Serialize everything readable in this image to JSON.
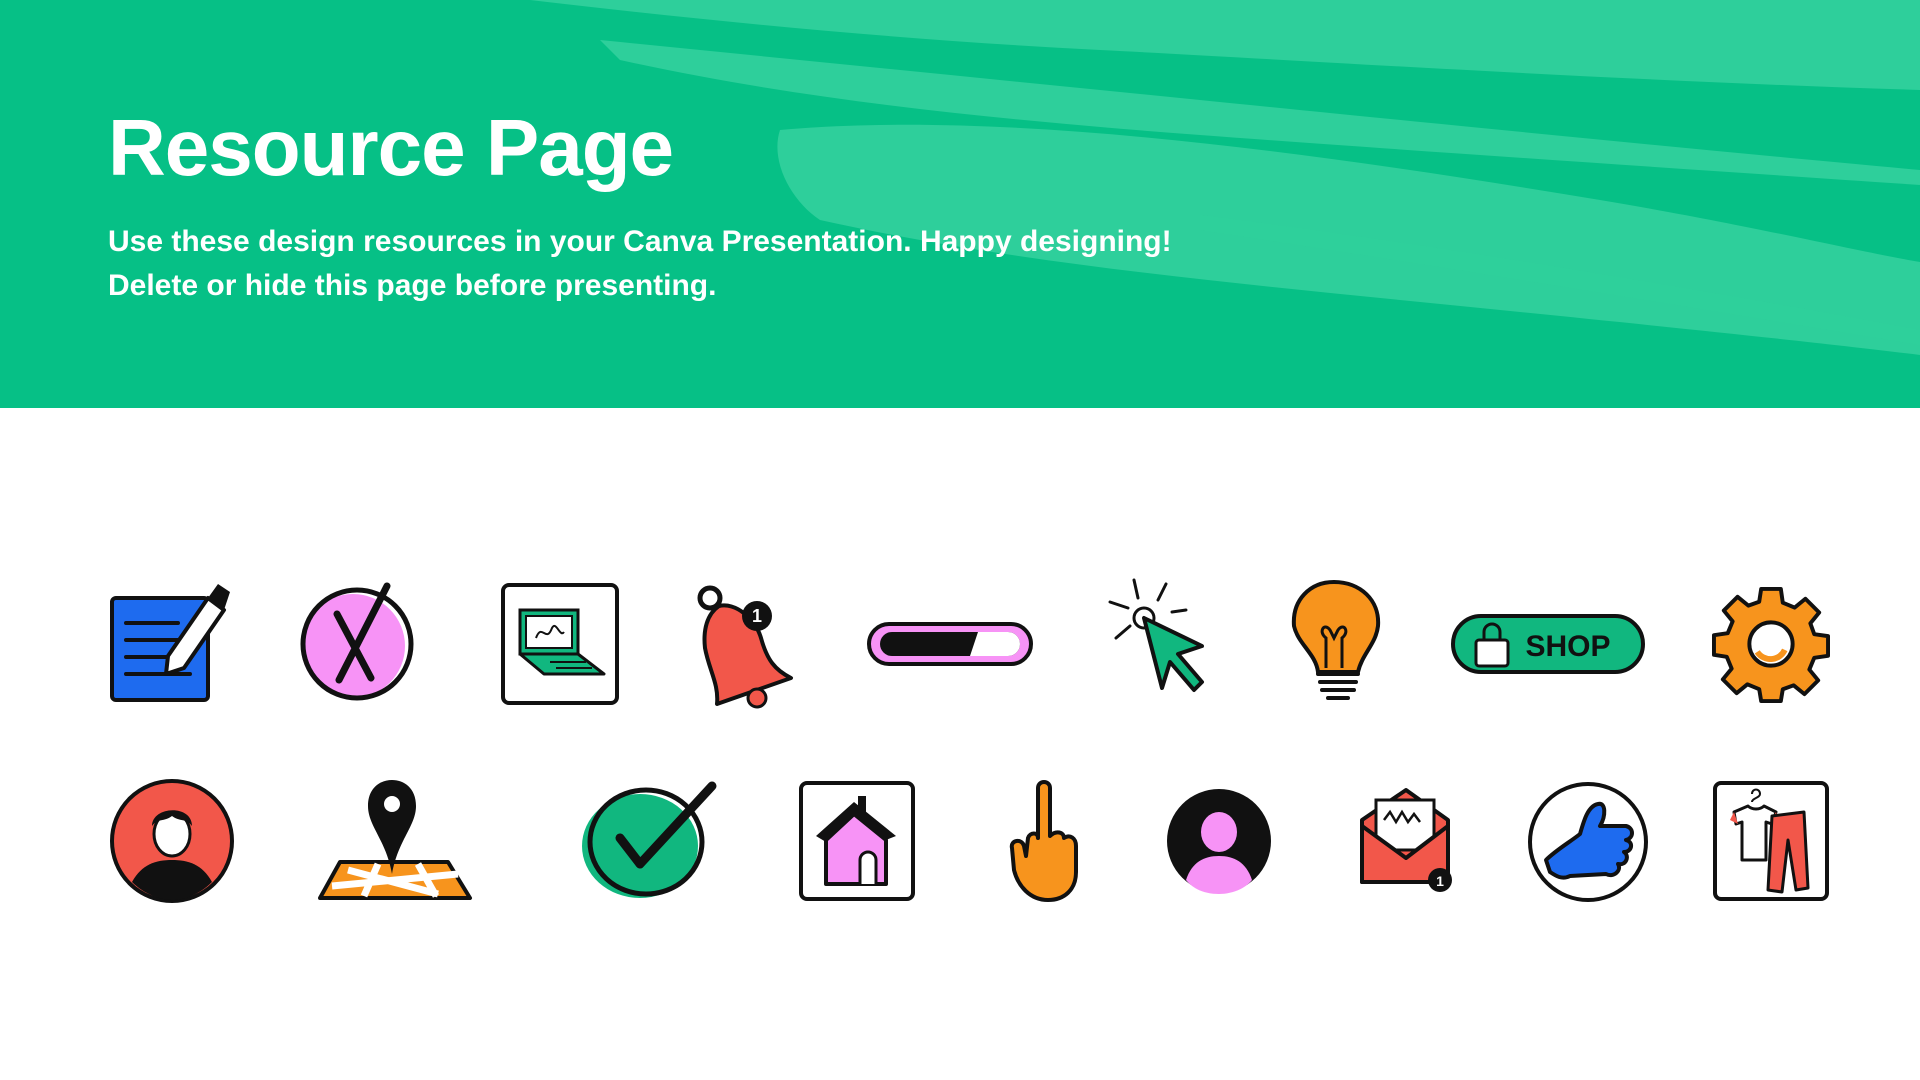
{
  "header": {
    "title": "Resource Page",
    "subtitle_line1": "Use these design resources in your Canva Presentation. Happy designing!",
    "subtitle_line2": "Delete or hide this page before presenting."
  },
  "colors": {
    "header_bg": "#06c086",
    "brush": "#2ecf9b",
    "blue": "#1e6bef",
    "pink": "#f793f6",
    "green": "#11b77f",
    "red": "#f2574a",
    "orange": "#f7941d",
    "black": "#111111"
  },
  "icons": {
    "row1": [
      {
        "name": "notepad-pencil-icon"
      },
      {
        "name": "cancel-x-circle-icon"
      },
      {
        "name": "laptop-icon"
      },
      {
        "name": "notification-bell-icon",
        "badge": "1"
      },
      {
        "name": "progress-bar-icon"
      },
      {
        "name": "click-cursor-icon"
      },
      {
        "name": "lightbulb-icon"
      },
      {
        "name": "shop-button-icon",
        "label": "SHOP"
      },
      {
        "name": "gear-icon"
      }
    ],
    "row2": [
      {
        "name": "user-avatar-icon"
      },
      {
        "name": "map-pin-icon"
      },
      {
        "name": "checkmark-circle-icon"
      },
      {
        "name": "home-icon"
      },
      {
        "name": "pointing-hand-icon"
      },
      {
        "name": "profile-circle-icon"
      },
      {
        "name": "mail-envelope-icon",
        "badge": "1"
      },
      {
        "name": "thumbs-up-icon"
      },
      {
        "name": "clothing-icon"
      }
    ]
  }
}
